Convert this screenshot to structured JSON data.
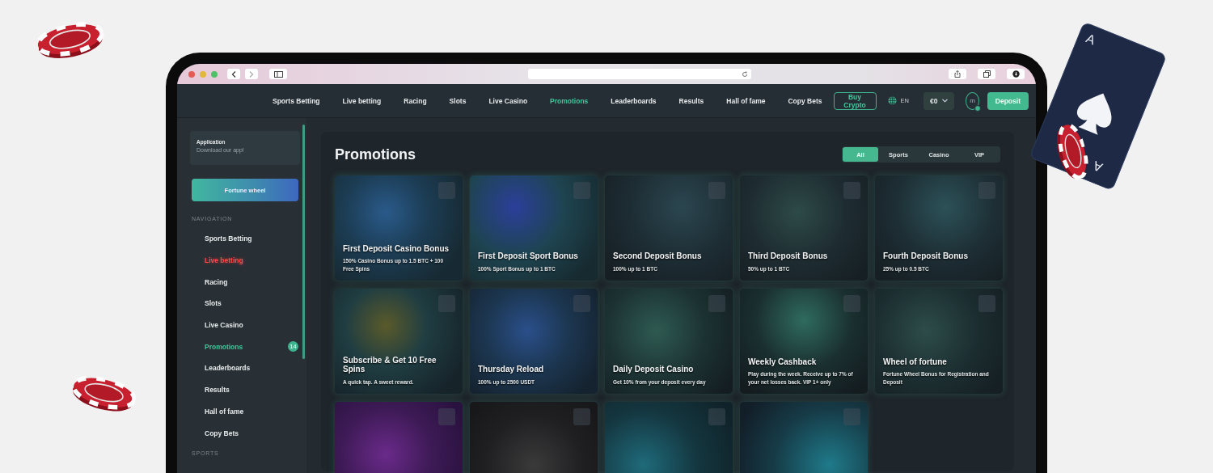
{
  "playing_card": {
    "corner_labels": [
      "A",
      "A"
    ]
  },
  "header": {
    "nav": [
      {
        "label": "Sports Betting",
        "selected": false
      },
      {
        "label": "Live betting",
        "selected": false
      },
      {
        "label": "Racing",
        "selected": false
      },
      {
        "label": "Slots",
        "selected": false
      },
      {
        "label": "Live Casino",
        "selected": false
      },
      {
        "label": "Promotions",
        "selected": true
      },
      {
        "label": "Leaderboards",
        "selected": false
      },
      {
        "label": "Results",
        "selected": false
      },
      {
        "label": "Hall of fame",
        "selected": false
      },
      {
        "label": "Copy Bets",
        "selected": false
      }
    ],
    "buy_button": "Buy Crypto",
    "language": "EN",
    "balance": "€0",
    "avatar": "m",
    "deposit_button": "Deposit"
  },
  "sidebar": {
    "app_card": {
      "title": "Application",
      "subtitle": "Download our app!"
    },
    "fortune_button": "Fortune wheel",
    "nav_heading": "NAVIGATION",
    "items": [
      {
        "label": "Sports Betting",
        "kind": "link",
        "selected": false
      },
      {
        "label": "Live betting",
        "kind": "live",
        "selected": false
      },
      {
        "label": "Racing",
        "kind": "link",
        "selected": false
      },
      {
        "label": "Slots",
        "kind": "link",
        "selected": false
      },
      {
        "label": "Live Casino",
        "kind": "link",
        "selected": false
      },
      {
        "label": "Promotions",
        "kind": "link",
        "selected": true,
        "badge": "14"
      },
      {
        "label": "Leaderboards",
        "kind": "link",
        "selected": false
      },
      {
        "label": "Results",
        "kind": "link",
        "selected": false
      },
      {
        "label": "Hall of fame",
        "kind": "link",
        "selected": false
      },
      {
        "label": "Copy Bets",
        "kind": "link",
        "selected": false
      }
    ],
    "sports_heading": "SPORTS"
  },
  "main": {
    "title": "Promotions",
    "filters": [
      {
        "label": "All",
        "selected": true
      },
      {
        "label": "Sports",
        "selected": false
      },
      {
        "label": "Casino",
        "selected": false
      },
      {
        "label": "VIP",
        "selected": false
      }
    ],
    "promos": [
      {
        "kind": "offer",
        "title": "First Deposit Casino Bonus",
        "description": "150% Casino Bonus up to 1.5 BTC + 100 Free Spins"
      },
      {
        "kind": "offer",
        "title": "First Deposit Sport Bonus",
        "description": "100% Sport Bonus up to 1 BTC"
      },
      {
        "kind": "offer",
        "title": "Second Deposit Bonus",
        "description": "100% up to 1 BTC"
      },
      {
        "kind": "offer",
        "title": "Third Deposit Bonus",
        "description": "50% up to 1 BTC"
      },
      {
        "kind": "offer",
        "title": "Fourth Deposit Bonus",
        "description": "25% up to 0.5 BTC"
      },
      {
        "kind": "offer",
        "title": "Subscribe & Get 10 Free Spins",
        "description": "A quick tap. A sweet reward."
      },
      {
        "kind": "offer",
        "title": "Thursday Reload",
        "description": "100% up to 2500 USDT"
      },
      {
        "kind": "offer",
        "title": "Daily Deposit Casino",
        "description": "Get 10% from your deposit every day"
      },
      {
        "kind": "offer",
        "title": "Weekly Cashback",
        "description": "Play during the week. Receive up to 7% of your net losses back. VIP 1+ only"
      },
      {
        "kind": "offer",
        "title": "Wheel of fortune",
        "description": "Fortune Wheel Bonus for Registration and Deposit"
      },
      {
        "kind": "image_only"
      },
      {
        "kind": "image_only"
      },
      {
        "kind": "image_only"
      },
      {
        "kind": "image_only"
      }
    ]
  }
}
